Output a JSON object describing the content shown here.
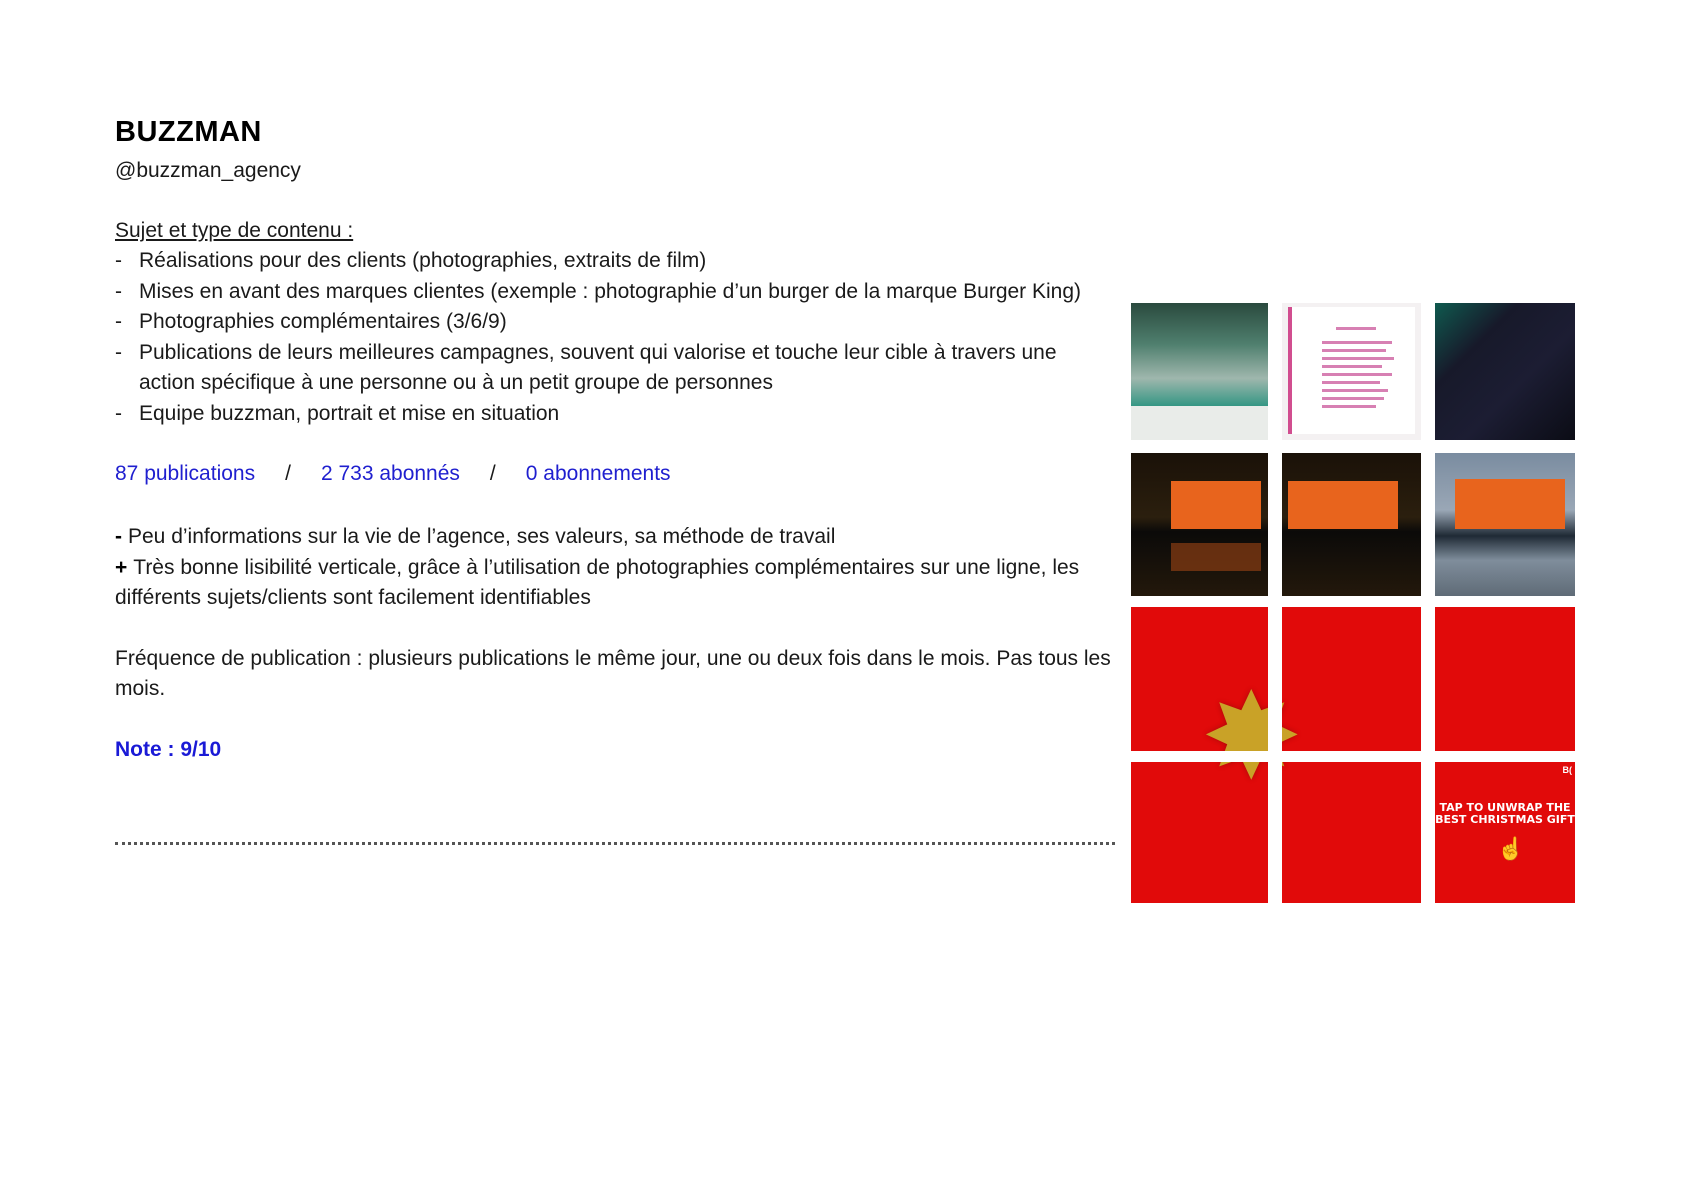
{
  "header": {
    "title": "BUZZMAN",
    "handle": "@buzzman_agency"
  },
  "content": {
    "section_label": "Sujet et type de contenu :",
    "bullet_symbol": "-",
    "topics": [
      "Réalisations pour des clients (photographies, extraits de film)",
      "Mises en avant des marques clientes (exemple : photographie d’un burger de la marque Burger King)",
      "Photographies complémentaires (3/6/9)",
      "Publications de leurs meilleures campagnes, souvent qui valorise et touche leur cible à travers une action spécifique à une personne ou à un petit groupe de personnes",
      "Equipe buzzman, portrait et mise en situation"
    ]
  },
  "stats": {
    "publications": "87 publications",
    "separator": "/",
    "followers": "2 733 abonnés",
    "following": "0 abonnements",
    "color": "#1f1fcf"
  },
  "assessment": {
    "minus_mark": "-",
    "minus_text": "Peu d’informations sur la vie de l’agence, ses valeurs, sa méthode de travail",
    "plus_mark": "+",
    "plus_text": "Très bonne lisibilité verticale, grâce à l’utilisation de photographies complémentaires sur une ligne, les différents sujets/clients sont facilement identifiables"
  },
  "frequency": "Fréquence de publication : plusieurs publications le même jour, une ou deux fois dans le mois. Pas tous les mois.",
  "note": {
    "text": "Note : 9/10",
    "color": "#1a1ad6"
  },
  "feed": {
    "gift_text": "TAP TO UNWRAP THE BEST CHRISTMAS GIFT",
    "gift_corner": "B(",
    "accent_red": "#e10a0a",
    "campaign_orange": "#e8641d"
  }
}
